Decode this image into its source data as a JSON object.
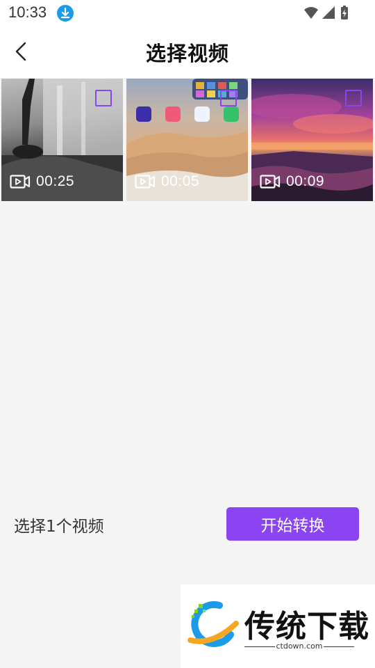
{
  "status_bar": {
    "time": "10:33",
    "icons": [
      "download-icon",
      "wifi-icon",
      "signal-icon",
      "battery-charging-icon"
    ]
  },
  "header": {
    "title": "选择视频",
    "back_icon": "back-arrow-icon"
  },
  "videos": [
    {
      "duration": "00:25",
      "selected": false,
      "thumbnail": "bedroom-window-bw"
    },
    {
      "duration": "00:05",
      "selected": false,
      "thumbnail": "phone-homescreen-desert"
    },
    {
      "duration": "00:09",
      "selected": false,
      "thumbnail": "sunset-seascape"
    }
  ],
  "footer": {
    "selection_text": "选择1个视频",
    "start_button_label": "开始转换"
  },
  "watermark": {
    "brand_text": "传统下载",
    "url": "ctdown.com"
  },
  "colors": {
    "accent": "#8b44f1",
    "background": "#f5f5f5",
    "header_bg": "#ffffff",
    "download_badge": "#1e9be8"
  }
}
